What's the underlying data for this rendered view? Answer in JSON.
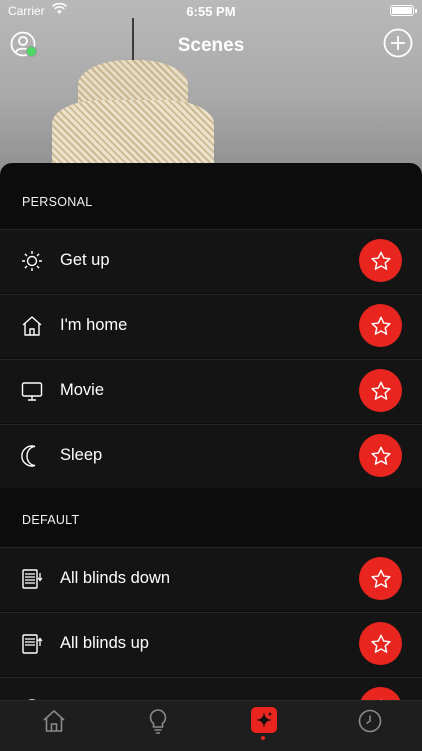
{
  "status_bar": {
    "carrier": "Carrier",
    "time": "6:55 PM"
  },
  "header": {
    "title": "Scenes",
    "profile_icon": "user-shield-icon",
    "add_icon": "plus-circle-icon"
  },
  "sections": [
    {
      "title": "PERSONAL",
      "items": [
        {
          "label": "Get up",
          "icon": "sun-icon"
        },
        {
          "label": "I'm home",
          "icon": "house-icon"
        },
        {
          "label": "Movie",
          "icon": "monitor-icon"
        },
        {
          "label": "Sleep",
          "icon": "moon-icon"
        }
      ]
    },
    {
      "title": "DEFAULT",
      "items": [
        {
          "label": "All blinds down",
          "icon": "blinds-down-icon"
        },
        {
          "label": "All blinds up",
          "icon": "blinds-up-icon"
        }
      ]
    }
  ],
  "favorite_icon": "star-icon",
  "tabs": [
    {
      "name": "home",
      "icon": "house-icon"
    },
    {
      "name": "lights",
      "icon": "lightbulb-icon"
    },
    {
      "name": "scenes",
      "icon": "sparkle-icon",
      "active": true
    },
    {
      "name": "timers",
      "icon": "clock-icon"
    }
  ],
  "colors": {
    "accent": "#e8251f",
    "background": "#0c0c0c",
    "row": "#141414",
    "online": "#4cd964"
  }
}
